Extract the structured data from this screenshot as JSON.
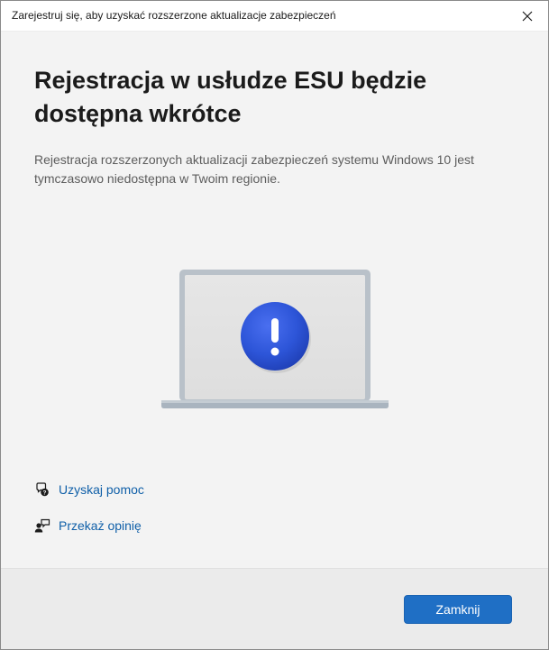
{
  "window": {
    "title": "Zarejestruj się, aby uzyskać rozszerzone aktualizacje zabezpieczeń",
    "close_icon": "close-icon"
  },
  "main": {
    "heading": "Rejestracja w usłudze ESU będzie dostępna wkrótce",
    "description": "Rejestracja rozszerzonych aktualizacji zabezpieczeń systemu Windows 10 jest tymczasowo niedostępna w Twoim regionie.",
    "illustration_icon": "laptop-exclamation-icon"
  },
  "links": [
    {
      "label": "Uzyskaj pomoc",
      "icon": "help-chat-icon"
    },
    {
      "label": "Przekaż opinię",
      "icon": "feedback-person-icon"
    }
  ],
  "footer": {
    "close_label": "Zamknij"
  },
  "colors": {
    "accent": "#1f6fc5",
    "link": "#0f5fa8",
    "alert_blue": "#2d55d8"
  }
}
